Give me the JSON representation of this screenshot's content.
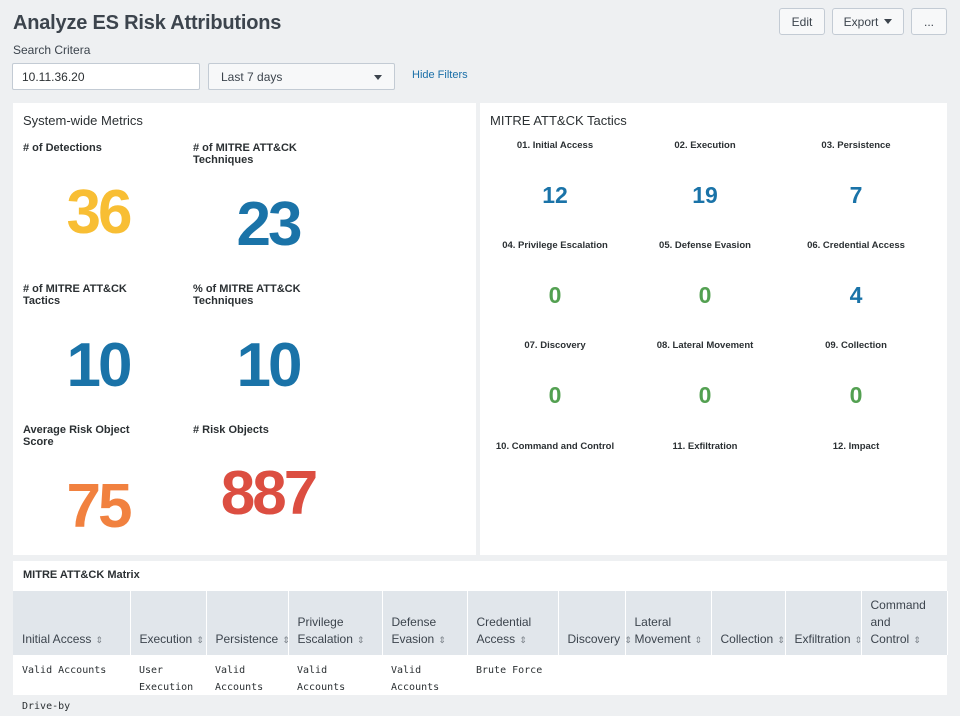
{
  "header": {
    "title": "Analyze ES Risk Attributions",
    "subtitle": "Search Critera",
    "edit_label": "Edit",
    "export_label": "Export",
    "more_label": "..."
  },
  "filters": {
    "search_value": "10.11.36.20",
    "time_range": "Last 7 days",
    "hide_filters": "Hide Filters"
  },
  "metrics_panel": {
    "title": "System-wide Metrics",
    "items": [
      {
        "label": "# of Detections",
        "value": "36",
        "color": "#f8be34"
      },
      {
        "label": "# of MITRE ATT&CK Techniques",
        "value": "23",
        "color": "#1a73a8"
      },
      {
        "label": "# of MITRE ATT&CK Tactics",
        "value": "10",
        "color": "#1a73a8"
      },
      {
        "label": "% of MITRE ATT&CK Techniques",
        "value": "10",
        "color": "#1a73a8"
      },
      {
        "label": "Average Risk Object Score",
        "value": "75",
        "color": "#f1813f"
      },
      {
        "label": "# Risk Objects",
        "value": "887",
        "color": "#dc4e41"
      }
    ]
  },
  "tactics_panel": {
    "title": "MITRE ATT&CK Tactics",
    "items": [
      {
        "label": "01. Initial Access",
        "value": "12",
        "color": "#1a73a8"
      },
      {
        "label": "02. Execution",
        "value": "19",
        "color": "#1a73a8"
      },
      {
        "label": "03. Persistence",
        "value": "7",
        "color": "#1a73a8"
      },
      {
        "label": "04. Privilege Escalation",
        "value": "0",
        "color": "#53a051"
      },
      {
        "label": "05. Defense Evasion",
        "value": "0",
        "color": "#53a051"
      },
      {
        "label": "06. Credential Access",
        "value": "4",
        "color": "#1a73a8"
      },
      {
        "label": "07. Discovery",
        "value": "0",
        "color": "#53a051"
      },
      {
        "label": "08. Lateral Movement",
        "value": "0",
        "color": "#53a051"
      },
      {
        "label": "09. Collection",
        "value": "0",
        "color": "#53a051"
      },
      {
        "label": "10. Command and Control",
        "value": "",
        "color": "#1a73a8"
      },
      {
        "label": "11. Exfiltration",
        "value": "",
        "color": "#1a73a8"
      },
      {
        "label": "12. Impact",
        "value": "",
        "color": "#1a73a8"
      }
    ]
  },
  "matrix": {
    "title": "MITRE ATT&CK Matrix",
    "sort_icon": "⇕",
    "columns": [
      "Initial Access",
      "Execution",
      "Persistence",
      "Privilege Escalation",
      "Defense Evasion",
      "Credential Access",
      "Discovery",
      "Lateral Movement",
      "Collection",
      "Exfiltration",
      "Command and Control"
    ],
    "rows": [
      [
        "Valid Accounts",
        "User Execution",
        "Valid Accounts",
        "Valid Accounts",
        "Valid Accounts",
        "Brute Force",
        "",
        "",
        "",
        "",
        ""
      ]
    ],
    "next_row_first_cell": "Drive-by"
  }
}
